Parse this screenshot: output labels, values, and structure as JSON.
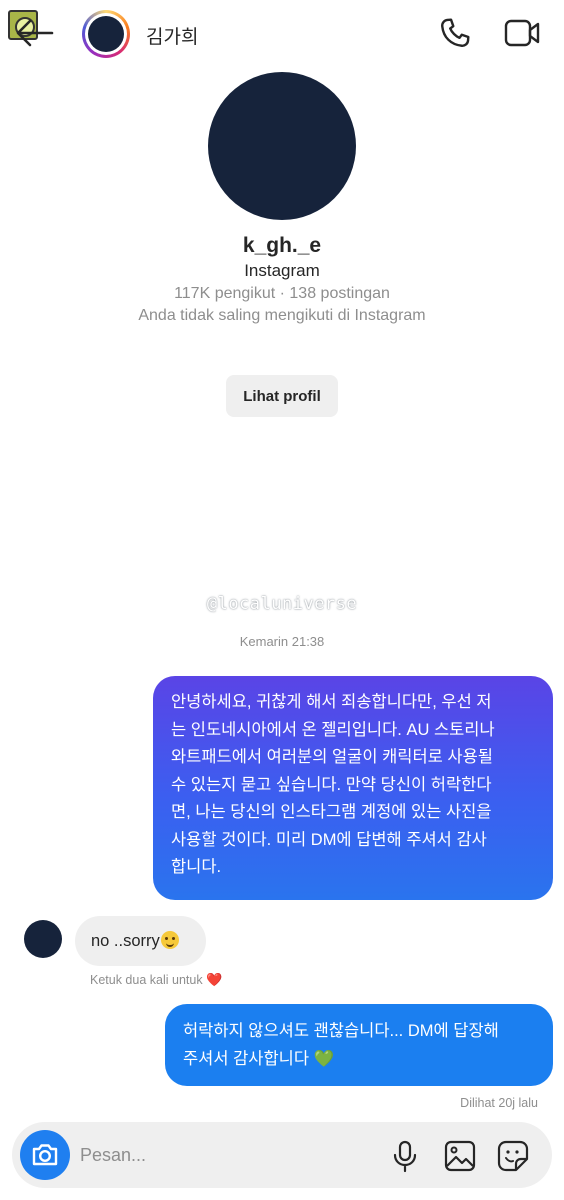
{
  "header": {
    "contact_name": "김가희",
    "icons": [
      "back-arrow-icon",
      "phone-icon",
      "video-camera-icon"
    ]
  },
  "profile": {
    "username": "k_gh._e",
    "platform": "Instagram",
    "stats": "117K pengikut · 138 postingan",
    "follow_note": "Anda tidak saling mengikuti di Instagram",
    "view_profile_label": "Lihat profil"
  },
  "watermark": "@localuniverse",
  "conversation": {
    "timestamp": "Kemarin 21:38",
    "messages": [
      {
        "direction": "outgoing",
        "lines": [
          "안녕하세요, 귀찮게 해서 죄송합니다만, 우선 저",
          "는 인도네시아에서 온 젤리입니다.  AU 스토리나",
          "와트패드에서 여러분의 얼굴이 캐릭터로 사용될",
          "수 있는지 묻고 싶습니다. 만약 당신이 허락한다",
          "면, 나는 당신의 인스타그램 계정에 있는 사진을",
          "사용할 것이다. 미리 DM에 답변해 주셔서 감사",
          "합니다."
        ]
      },
      {
        "direction": "incoming",
        "text": "no ..sorry",
        "emoji": "smiling-face-with-tear",
        "hint": "Ketuk dua kali untuk",
        "hint_emoji": "❤️"
      },
      {
        "direction": "outgoing",
        "lines": [
          "허락하지 않으셔도 괜찮습니다... DM에 답장해",
          "주셔서 감사합니다 "
        ],
        "emoji": "💚"
      }
    ],
    "seen_status": "Dilihat 20j lalu"
  },
  "composer": {
    "placeholder": "Pesan...",
    "icons": [
      "camera-icon",
      "microphone-icon",
      "gallery-icon",
      "sticker-icon"
    ]
  },
  "colors": {
    "outgoing_bubble_top": "#5a44e6",
    "outgoing_bubble_bottom": "#2a74ee",
    "outgoing_bubble_2": "#1b7ff0",
    "incoming_bubble": "#efefef",
    "secondary_text": "#8e8e8e",
    "camera_button": "#1f7ff0"
  }
}
